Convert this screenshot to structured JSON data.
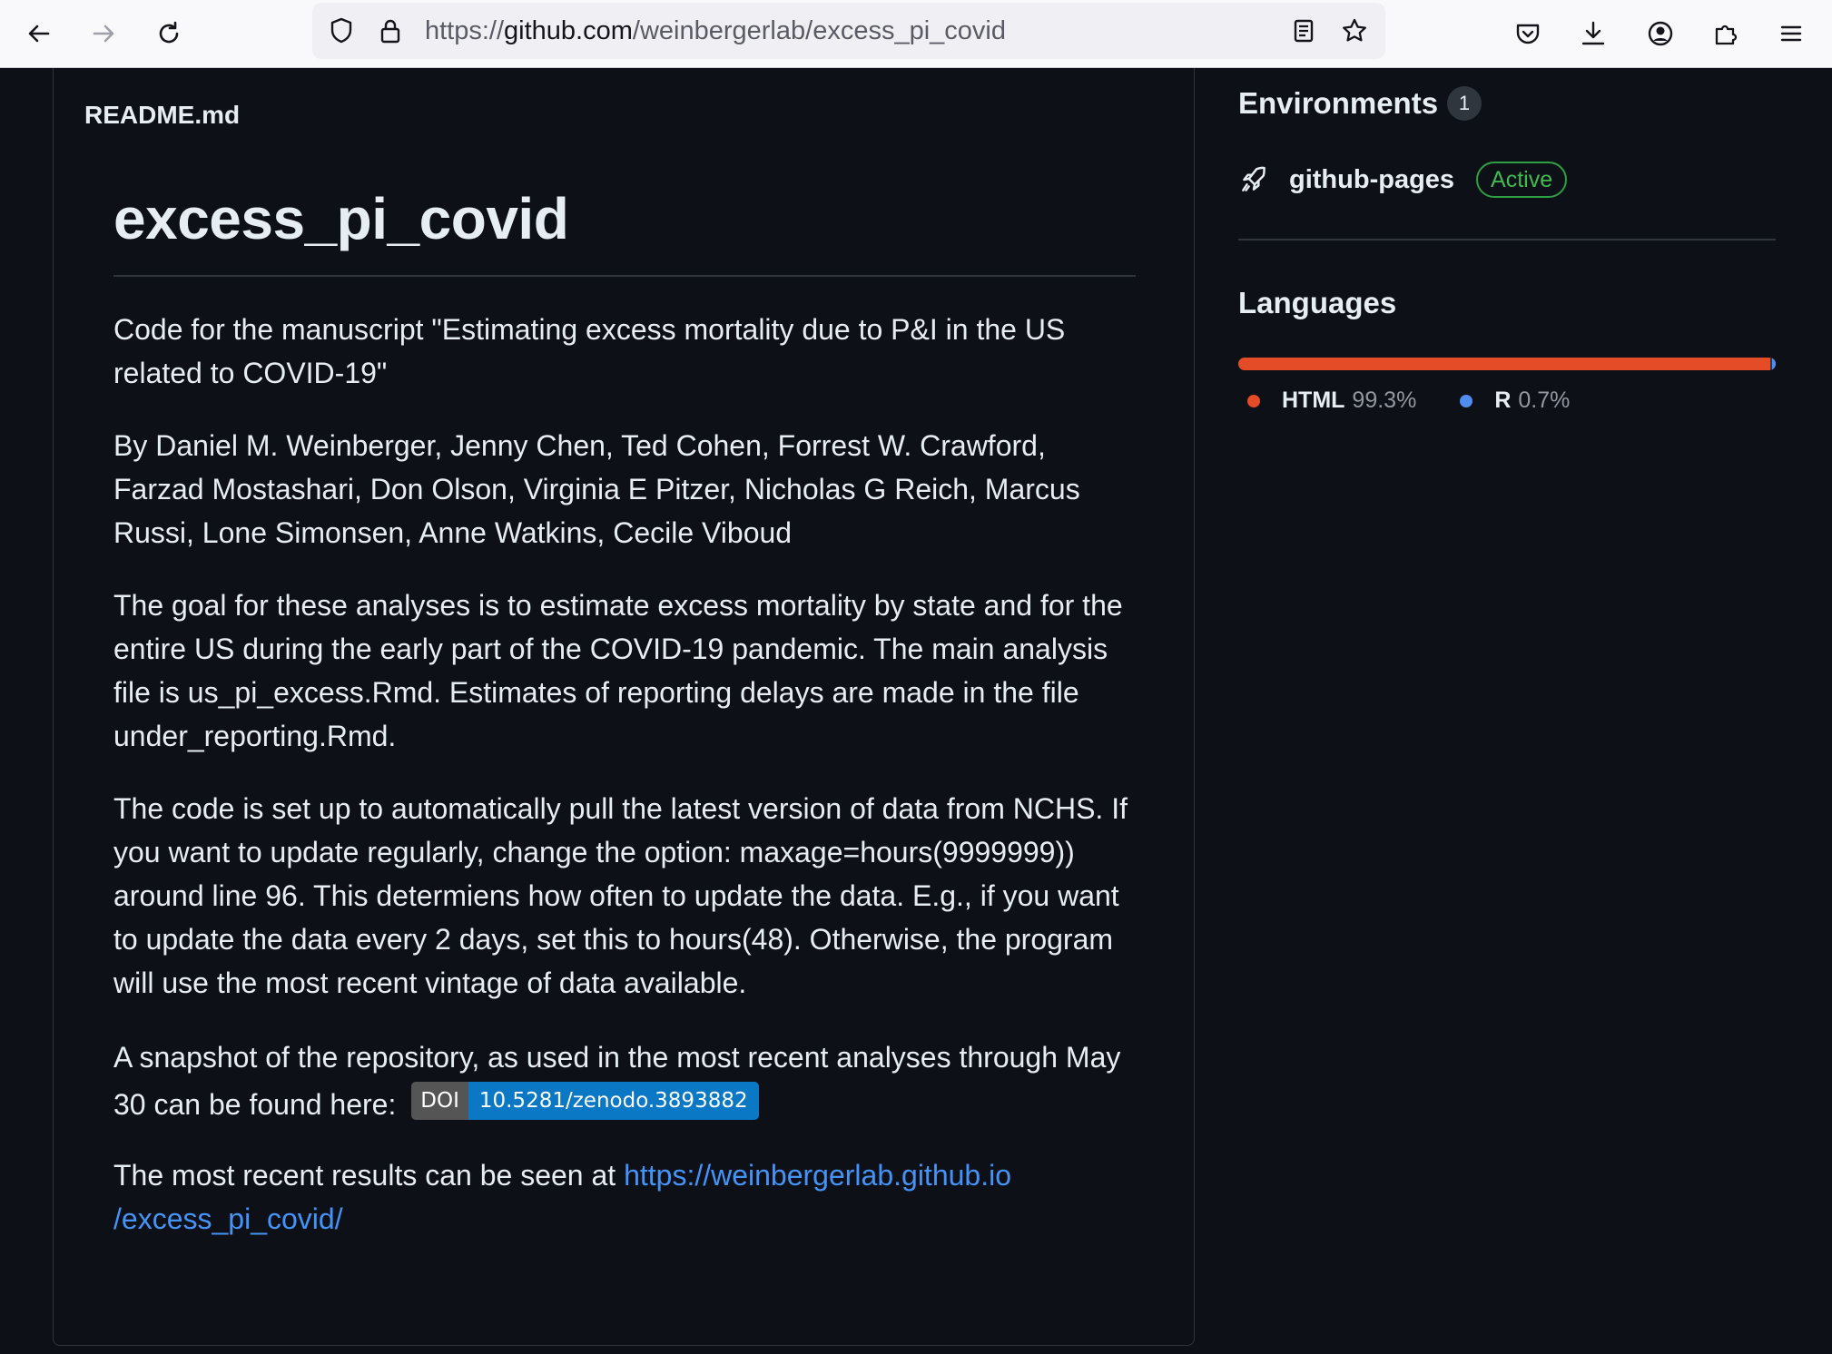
{
  "browser": {
    "url_scheme": "https://",
    "url_host": "github.com",
    "url_path": "/weinbergerlab/excess_pi_covid"
  },
  "readme": {
    "filename": "README.md",
    "title": "excess_pi_covid",
    "p1": "Code for the manuscript \"Estimating excess mortality due to P&I in the US related to COVID-19\"",
    "p2": "By Daniel M. Weinberger, Jenny Chen, Ted Cohen, Forrest W. Crawford, Farzad Mostashari, Don Olson, Virginia E Pitzer, Nicholas G Reich, Marcus Russi, Lone Simonsen, Anne Watkins, Cecile Viboud",
    "p3": "The goal for these analyses is to estimate excess mortality by state and for the entire US during the early part of the COVID-19 pandemic. The main analysis file is us_pi_excess.Rmd. Estimates of reporting delays are made in the file under_reporting.Rmd.",
    "p4": "The code is set up to automatically pull the latest version of data from NCHS. If you want to update regularly, change the option: maxage=hours(9999999)) around line 96. This determiens how often to update the data. E.g., if you want to update the data every 2 days, set this to hours(48). Otherwise, the program will use the most recent vintage of data available.",
    "p5_text": "A snapshot of the repository, as used in the most recent analyses through May 30 can be found here:",
    "doi_label": "DOI",
    "doi_value": "10.5281/zenodo.3893882",
    "p6_text": "The most recent results can be seen at",
    "p6_link_line1": "https://weinbergerlab.github.io",
    "p6_link_line2": "/excess_pi_covid/"
  },
  "sidebar": {
    "environments_heading": "Environments",
    "environments_count": "1",
    "env_name": "github-pages",
    "env_status": "Active",
    "languages_heading": "Languages",
    "languages": [
      {
        "name": "HTML",
        "percent": "99.3%",
        "value": 99.3,
        "color": "#e34c26"
      },
      {
        "name": "R",
        "percent": "0.7%",
        "value": 0.7,
        "color": "#4f8ef0"
      }
    ]
  }
}
